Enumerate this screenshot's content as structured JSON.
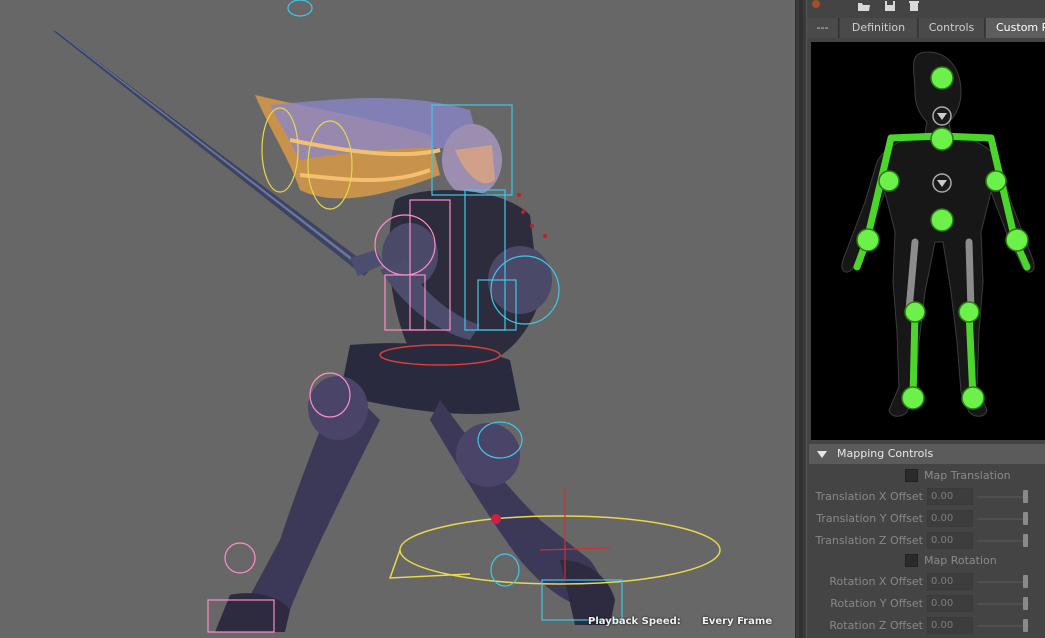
{
  "viewport": {
    "hud": {
      "playback_label": "Playback Speed:",
      "playback_value": "Every Frame"
    }
  },
  "panel": {
    "toolbar_icons": [
      "settings-icon",
      "folder-open-icon",
      "save-icon",
      "delete-icon"
    ],
    "tabs": [
      {
        "label": "---"
      },
      {
        "label": "Definition"
      },
      {
        "label": "Controls"
      },
      {
        "label": "Custom R"
      }
    ],
    "active_tab": "Custom R",
    "mapping": {
      "title": "Mapping Controls",
      "map_translation": "Map Translation",
      "translation_fields": [
        {
          "label": "Translation X Offset",
          "value": "0.00"
        },
        {
          "label": "Translation Y Offset",
          "value": "0.00"
        },
        {
          "label": "Translation Z Offset",
          "value": "0.00"
        }
      ],
      "map_rotation": "Map Rotation",
      "rotation_fields": [
        {
          "label": "Rotation X Offset",
          "value": "0.00"
        },
        {
          "label": "Rotation Y Offset",
          "value": "0.00"
        },
        {
          "label": "Rotation Z Offset",
          "value": "0.00"
        }
      ]
    }
  },
  "colors": {
    "viewport_bg": "#676767",
    "panel_bg": "#444444",
    "joint_green": "#4cd62c",
    "selection_cyan": "#3ec8e8",
    "selection_yellow": "#e8d84a",
    "selection_pink": "#ff8cc8",
    "hair_orange": "#e8a040"
  }
}
